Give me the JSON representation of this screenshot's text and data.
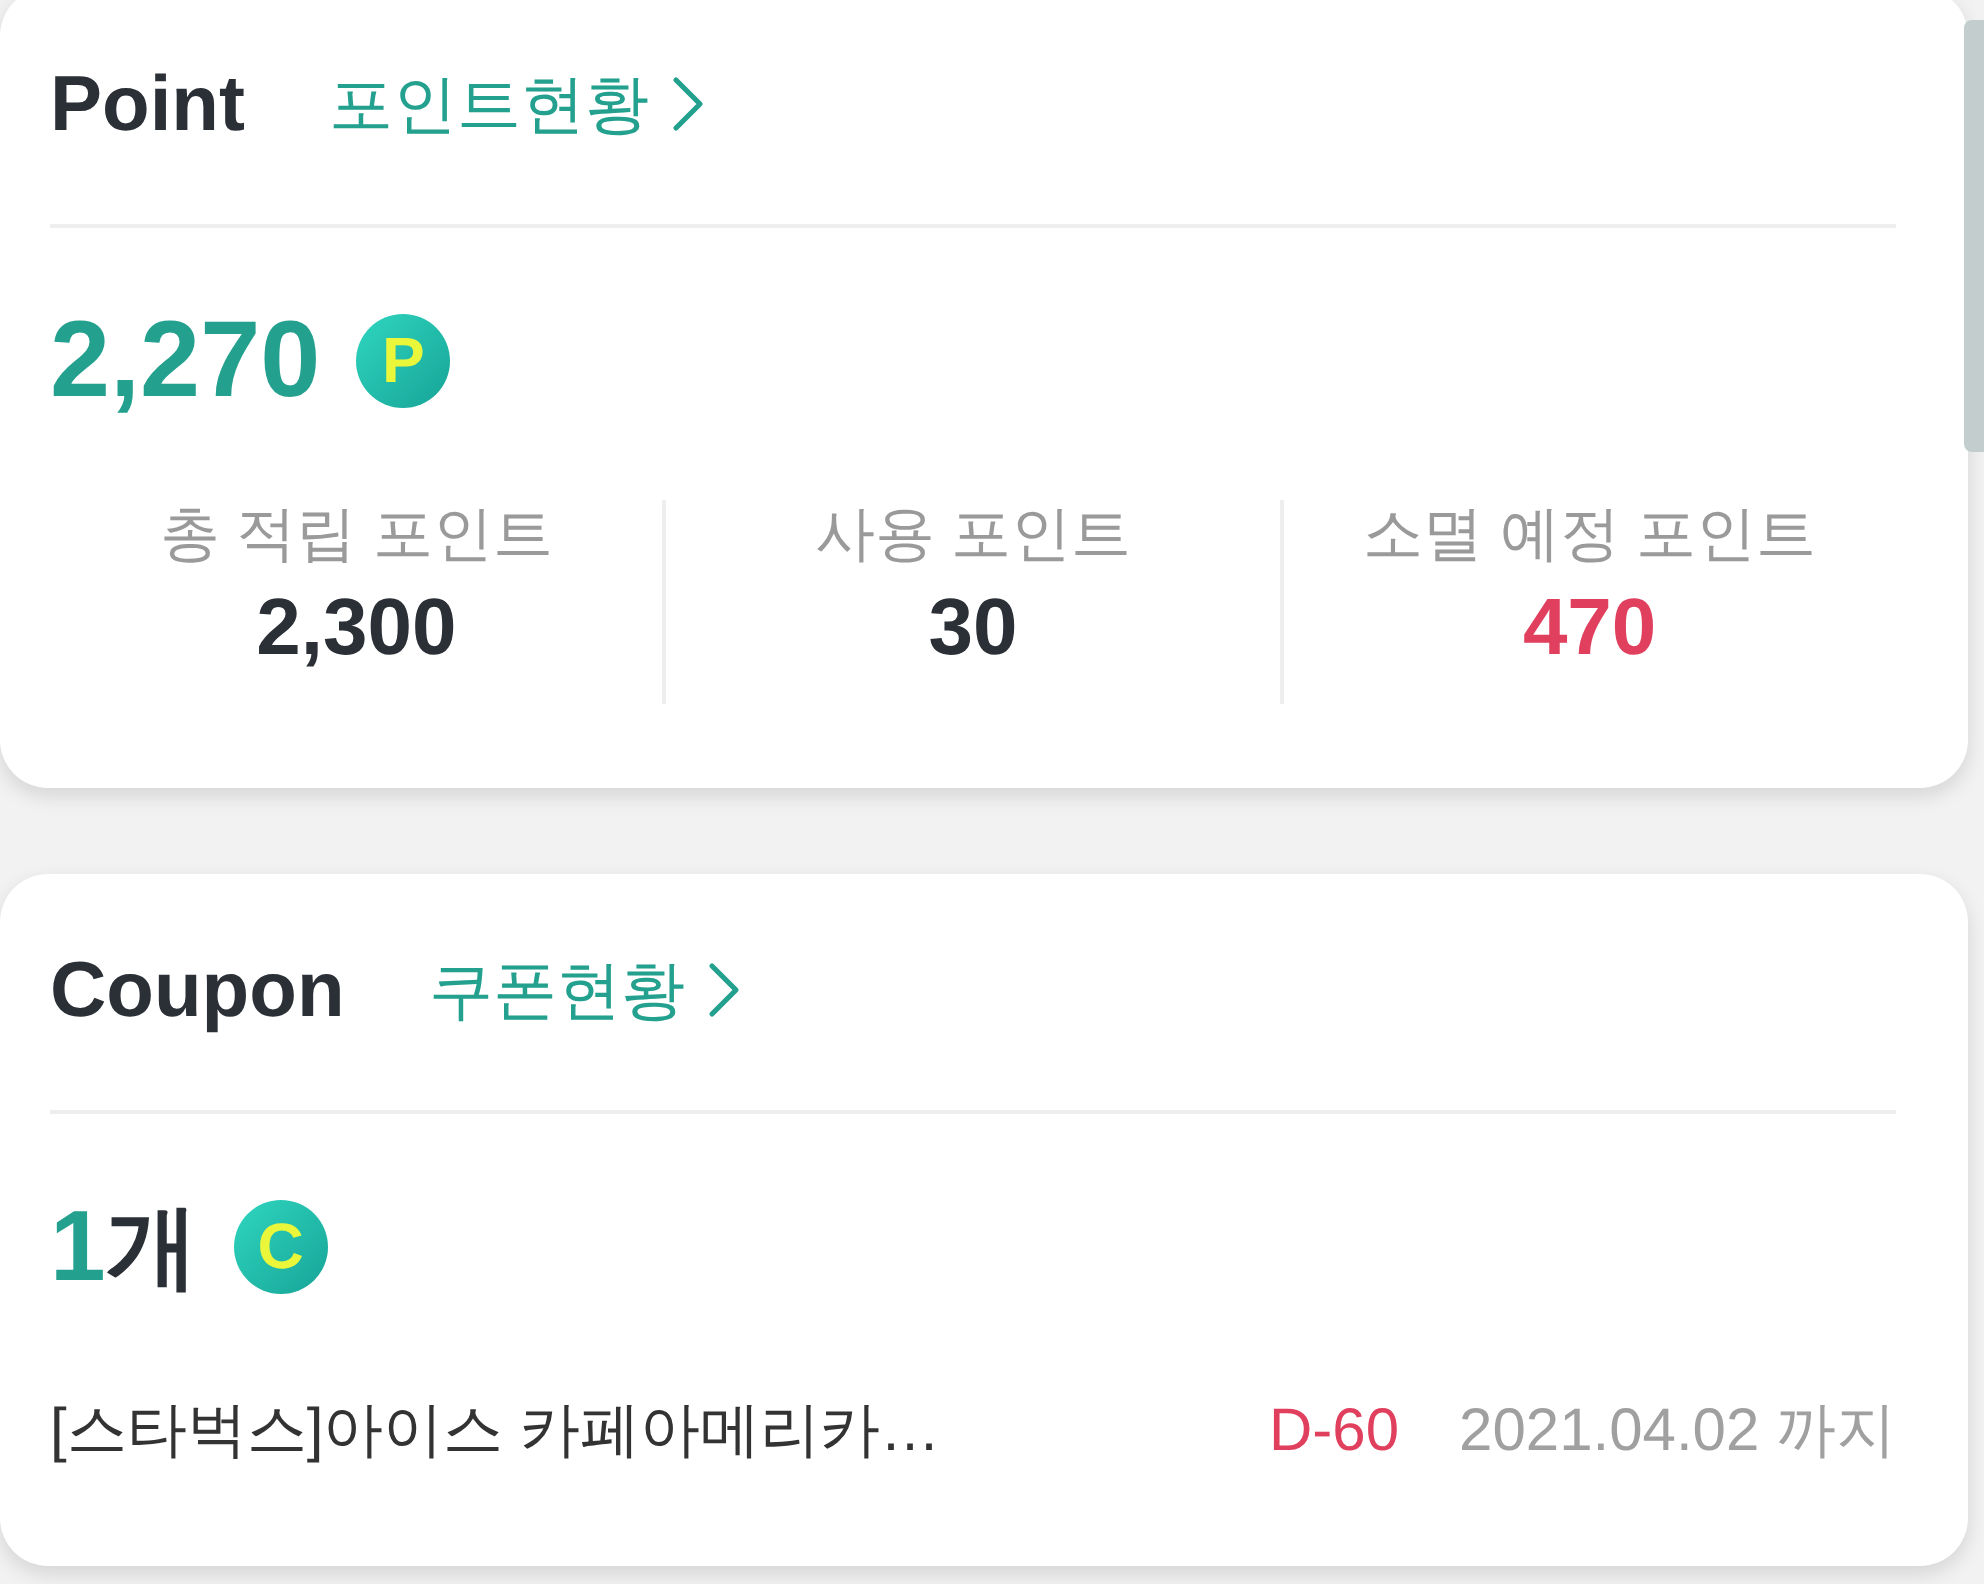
{
  "point_card": {
    "title": "Point",
    "link": {
      "label": "포인트현황"
    },
    "amount": "2,270",
    "badge": "P",
    "stats": [
      {
        "label": "총 적립 포인트",
        "value": "2,300",
        "color": "#2b2f36"
      },
      {
        "label": "사용 포인트",
        "value": "30",
        "color": "#2b2f36"
      },
      {
        "label": "소멸 예정 포인트",
        "value": "470",
        "color": "#e0405e"
      }
    ]
  },
  "coupon_card": {
    "title": "Coupon",
    "link": {
      "label": "쿠폰현황"
    },
    "count": "1",
    "unit": "개",
    "badge": "C",
    "coupons": [
      {
        "name": "[스타벅스]아이스 카페아메리카…",
        "d_day": "D-60",
        "expiry": "2021.04.02 까지"
      }
    ]
  }
}
